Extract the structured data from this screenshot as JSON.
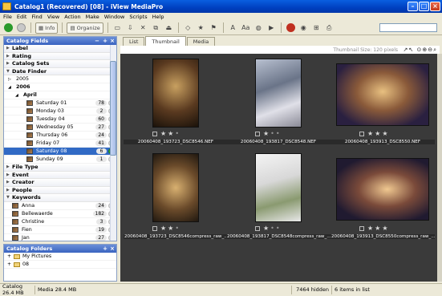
{
  "title_bar": {
    "text": "Catalog1 (Recovered) [08] - iView MediaPro"
  },
  "menu": [
    "File",
    "Edit",
    "Find",
    "View",
    "Action",
    "Make",
    "Window",
    "Scripts",
    "Help"
  ],
  "toolbar": {
    "info_label": "Info",
    "organize_label": "Organize"
  },
  "left_panel": {
    "header": "Catalog Fields",
    "sections_top": [
      "Label",
      "Rating",
      "Catalog Sets",
      "Date Finder"
    ],
    "years": [
      "2005",
      "2006"
    ],
    "month": "April",
    "days": [
      {
        "label": "Saturday 01",
        "count": "78",
        "selected": false,
        "green": false
      },
      {
        "label": "Monday 03",
        "count": "2",
        "selected": false,
        "green": false
      },
      {
        "label": "Tuesday 04",
        "count": "60",
        "selected": false,
        "green": false
      },
      {
        "label": "Wednesday 05",
        "count": "27",
        "selected": false,
        "green": false
      },
      {
        "label": "Thursday 06",
        "count": "24",
        "selected": false,
        "green": false
      },
      {
        "label": "Friday 07",
        "count": "41",
        "selected": false,
        "green": false
      },
      {
        "label": "Saturday 08",
        "count": "6",
        "selected": true,
        "green": true
      },
      {
        "label": "Sunday 09",
        "count": "1",
        "selected": false,
        "green": false
      }
    ],
    "sections_mid": [
      "File Type",
      "Event",
      "Creator",
      "People",
      "Keywords"
    ],
    "keywords": [
      {
        "label": "Anna",
        "count": "24"
      },
      {
        "label": "Bellewaerde",
        "count": "182"
      },
      {
        "label": "Christine",
        "count": "3"
      },
      {
        "label": "Fien",
        "count": "19"
      },
      {
        "label": "Jan",
        "count": "27"
      }
    ]
  },
  "folders_panel": {
    "header": "Catalog Folders",
    "items": [
      "My Pictures",
      "08"
    ]
  },
  "tabs": [
    "List",
    "Thumbnail",
    "Media"
  ],
  "thumbnail_size": "Thumbnail Size: 120 pixels",
  "grid_icons": "↗↖ ⊙⊕⊖⌕",
  "thumbnails": [
    {
      "file": "20060408_193723_DSC8546.NEF",
      "stars": 2
    },
    {
      "file": "20060408_193817_DSC8548.NEF",
      "stars": 1
    },
    {
      "file": "20060408_193913_DSC8550.NEF",
      "stars": 3
    },
    {
      "file": "20060408_193723_DSC8546compress_raw_...",
      "stars": 2
    },
    {
      "file": "20060408_193817_DSC8548compress_raw_...",
      "stars": 1
    },
    {
      "file": "20060408_193913_DSC8550compress_raw_...",
      "stars": 3
    }
  ],
  "status": {
    "catalog": "Catalog  26.4 MB",
    "media": "Media 28.4 MB",
    "hidden": "7464 hidden",
    "items": "6 items in list"
  }
}
